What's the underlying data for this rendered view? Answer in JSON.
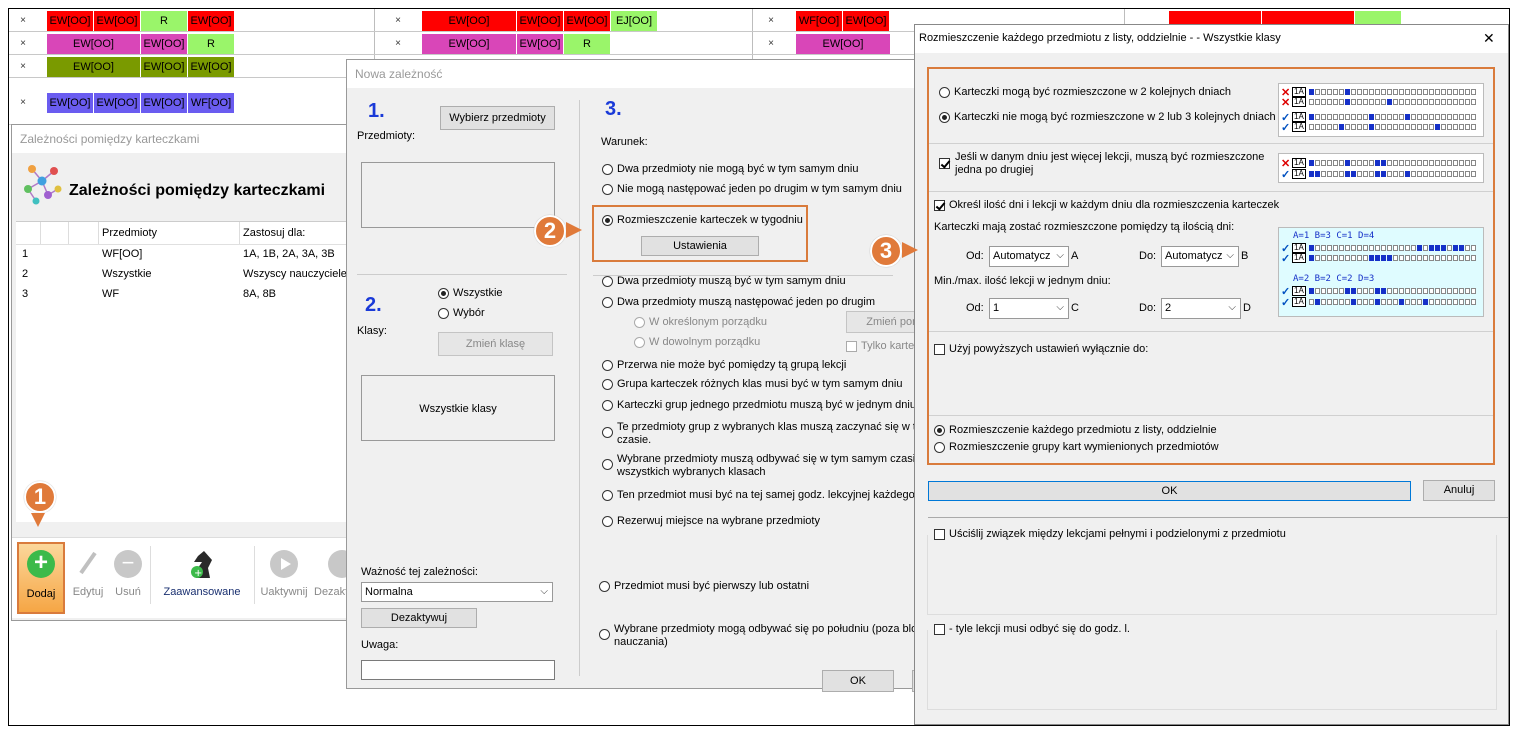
{
  "bg": {
    "row1a": [
      "×",
      "EW[OO]",
      "EW[OO]",
      "R",
      "EW[OO]"
    ],
    "row2a": [
      "×",
      "EW[OO]",
      "EW[OO]",
      "R"
    ],
    "row3a": [
      "×",
      "EW[OO]",
      "EW[OO]",
      "EW[OO]"
    ],
    "row4a": [
      "×",
      "EW[OO]",
      "EW[OO]",
      "EW[OO]",
      "WF[OO]"
    ],
    "row1b": [
      "×",
      "EW[OO]",
      "EW[OO]",
      "EW[OO]",
      "EJ[OO]"
    ],
    "row2b": [
      "×",
      "EW[OO]",
      "EW[OO]",
      "R"
    ],
    "row1c": [
      "×",
      "WF[OO]",
      "EW[OO]"
    ],
    "row2c": [
      "×",
      "EW[OO]"
    ],
    "colors": {
      "red": "#ff0000",
      "magenta": "#d946b8",
      "olive": "#7a9a00",
      "blue": "#6a5cf0",
      "green": "#9af56a"
    }
  },
  "deps": {
    "title": "Zależności pomiędzy karteczkami",
    "heading": "Zależności pomiędzy karteczkami",
    "columns": [
      "",
      "",
      "Przedmioty",
      "Zastosuj dla:"
    ],
    "rows": [
      [
        "1",
        "WF[OO]",
        "1A, 1B, 2A, 3A, 3B"
      ],
      [
        "2",
        "Wszystkie",
        "Wszyscy nauczyciele"
      ],
      [
        "3",
        "WF",
        "8A, 8B"
      ]
    ],
    "toolbar": {
      "add": "Dodaj",
      "edit": "Edytuj",
      "remove": "Usuń",
      "advanced": "Zaawansowane",
      "activate": "Uaktywnij",
      "deactivate": "Dezaktywuj"
    }
  },
  "nowa": {
    "title": "Nowa zależność",
    "step1": "1.",
    "subjects_label": "Przedmioty:",
    "choose_subjects": "Wybierz przedmioty",
    "step2": "2.",
    "classes_label": "Klasy:",
    "opt_all": "Wszystkie",
    "opt_choice": "Wybór",
    "change_class": "Zmień klasę",
    "all_classes": "Wszystkie klasy",
    "validity_label": "Ważność tej zależności:",
    "validity_value": "Normalna",
    "deactivate": "Dezaktywuj",
    "note_label": "Uwaga:",
    "step3": "3.",
    "condition_label": "Warunek:",
    "conditions": [
      "Dwa przedmioty nie mogą być w tym samym dniu",
      "Nie mogą następować jeden po drugim w tym samym dniu",
      "Rozmieszczenie karteczek w tygodniu",
      "Dwa przedmioty muszą być w tym samym dniu",
      "Dwa przedmioty muszą następować jeden po drugim",
      "Przerwa nie może być pomiędzy tą grupą lekcji",
      "Grupa karteczek różnych klas musi być w tym samym dniu",
      "Karteczki grup jednego przedmiotu muszą być w jednym dniu",
      "Te przedmioty grup z wybranych klas muszą zaczynać się w tym",
      "czasie.",
      "Wybrane przedmioty muszą odbywać się w tym samym czasie w",
      "wszystkich wybranych klasach",
      "Ten przedmiot musi być na tej samej godz. lekcyjnej każdego dn",
      "Rezerwuj miejsce na wybrane przedmioty",
      "Przedmiot musi być pierwszy lub ostatni",
      "Wybrane przedmioty mogą odbywać się po południu (poza blokie",
      "nauczania)"
    ],
    "settings_btn": "Ustawienia",
    "order_fixed": "W określonym porządku",
    "order_any": "W dowolnym porządku",
    "change_btn": "Zmień por",
    "only_cards": "Tylko kartecz",
    "ok": "OK"
  },
  "dist": {
    "title": "Rozmieszczenie każdego przedmiotu z listy, oddzielnie -  - Wszystkie klasy",
    "close": "✕",
    "opt_consecutive": "Karteczki mogą być rozmieszczone w 2 kolejnych dniach",
    "opt_not_consecutive": "Karteczki nie mogą być rozmieszczone w 2 lub 3 kolejnych dniach",
    "more_lessons": "Jeśli w danym dniu jest więcej lekcji, muszą być rozmieszczone",
    "more_lessons2": "jedna po drugiej",
    "specify": "Określ ilość dni i lekcji w każdym dniu dla rozmieszczenia karteczek",
    "days_label": "Karteczki mają zostać rozmieszczone pomiędzy tą ilością dni:",
    "od": "Od:",
    "do": "Do:",
    "auto": "Automatycz",
    "A": "A",
    "B": "B",
    "C": "C",
    "D": "D",
    "minmax_label": "Min./max. ilość lekcji w jednym dniu:",
    "c_val": "1",
    "d_val": "2",
    "sample1": "A=1 B=3 C=1 D=4",
    "sample2": "A=2 B=2 C=2 D=3",
    "sample_tag": "1A",
    "use_only": "Użyj powyższych ustawień wyłącznie do:",
    "each_sep": "Rozmieszczenie każdego przedmiotu z listy, oddzielnie",
    "group": "Rozmieszczenie grupy kart wymienionych przedmiotów",
    "ok": "OK",
    "cancel": "Anuluj",
    "refine": "Uściślij związek między lekcjami pełnymi i podzielonymi z przedmiotu",
    "lessons_until": "- tyle lekcji musi odbyć się do godz. l."
  },
  "badges": {
    "one": "1",
    "two": "2",
    "three": "3"
  },
  "colors": {
    "accent": "#d97b3c",
    "step": "#1a3ad8",
    "blueSquare": "#1530c8"
  }
}
